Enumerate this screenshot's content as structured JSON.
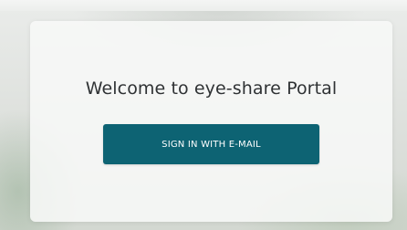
{
  "portal": {
    "title": "Welcome to eye-share Portal",
    "sign_in_button_label": "SIGN IN WITH E-MAIL"
  },
  "colors": {
    "button_background": "#0d6373",
    "button_text": "#ffffff",
    "title_text": "#2f3234",
    "card_background": "#f7f8f7"
  }
}
